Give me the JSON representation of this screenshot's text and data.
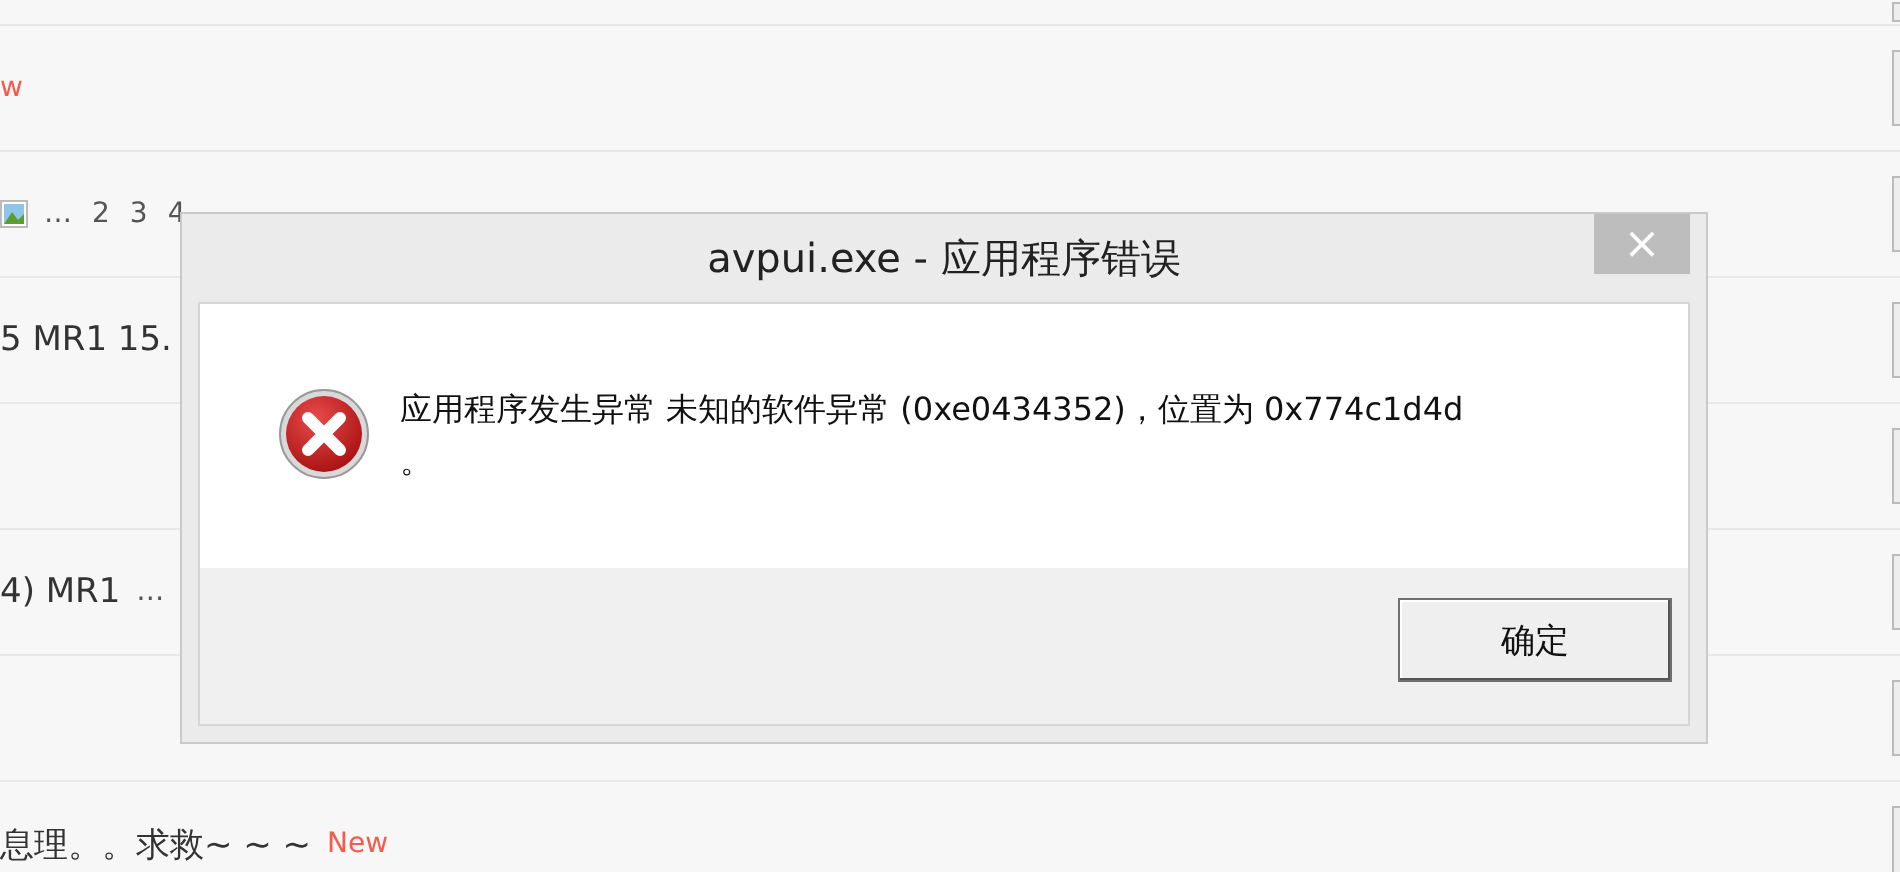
{
  "forum_rows": [
    {},
    {
      "new_tag": "w"
    },
    {
      "has_image_icon": true,
      "pages": [
        "…",
        "2",
        "3",
        "4"
      ]
    },
    {
      "title": "5 MR1 15."
    },
    {},
    {
      "title": "4) MR1",
      "pages": [
        "…"
      ]
    },
    {},
    {
      "title": "息理。。求救~ ~ ~",
      "new_tag": "New"
    }
  ],
  "dialog": {
    "title": "avpui.exe - 应用程序错误",
    "close": "×",
    "message": "应用程序发生异常 未知的软件异常 (0xe0434352)，位置为 0x774c1d4d\n。",
    "buttons": [
      "确定"
    ]
  }
}
